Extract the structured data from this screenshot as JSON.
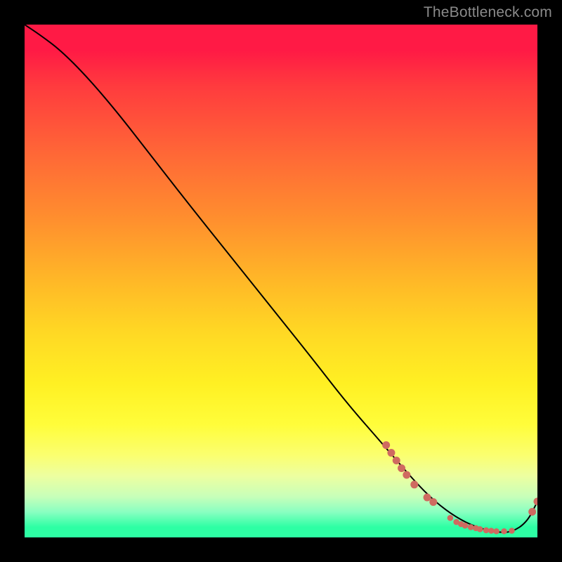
{
  "watermark": "TheBottleneck.com",
  "chart_data": {
    "type": "line",
    "title": "",
    "xlabel": "",
    "ylabel": "",
    "xlim": [
      0,
      100
    ],
    "ylim": [
      0,
      100
    ],
    "grid": false,
    "legend": false,
    "series": [
      {
        "name": "bottleneck-curve",
        "color": "#000000",
        "x": [
          0,
          3,
          7,
          12,
          18,
          25,
          32,
          40,
          48,
          56,
          63,
          70,
          76,
          80,
          84,
          88,
          92,
          95,
          98,
          100
        ],
        "y": [
          100,
          98,
          95,
          90,
          83,
          74,
          65,
          55,
          45,
          35,
          26,
          18,
          11,
          7,
          4,
          2,
          1,
          1,
          3,
          7
        ]
      }
    ],
    "markers": {
      "name": "highlighted-points",
      "color": "#cf6a60",
      "radius_large": 5.5,
      "radius_small": 4.3,
      "points": [
        {
          "x": 70.5,
          "y": 18.0,
          "r": "large"
        },
        {
          "x": 71.5,
          "y": 16.5,
          "r": "large"
        },
        {
          "x": 72.5,
          "y": 15.0,
          "r": "large"
        },
        {
          "x": 73.5,
          "y": 13.5,
          "r": "large"
        },
        {
          "x": 74.5,
          "y": 12.2,
          "r": "large"
        },
        {
          "x": 76.0,
          "y": 10.3,
          "r": "large"
        },
        {
          "x": 78.5,
          "y": 7.8,
          "r": "large"
        },
        {
          "x": 79.7,
          "y": 6.9,
          "r": "large"
        },
        {
          "x": 83.0,
          "y": 3.8,
          "r": "small"
        },
        {
          "x": 84.2,
          "y": 3.0,
          "r": "small"
        },
        {
          "x": 85.1,
          "y": 2.6,
          "r": "small"
        },
        {
          "x": 85.9,
          "y": 2.3,
          "r": "small"
        },
        {
          "x": 87.0,
          "y": 2.0,
          "r": "small"
        },
        {
          "x": 88.0,
          "y": 1.8,
          "r": "small"
        },
        {
          "x": 88.8,
          "y": 1.6,
          "r": "small"
        },
        {
          "x": 90.0,
          "y": 1.4,
          "r": "small"
        },
        {
          "x": 91.0,
          "y": 1.3,
          "r": "small"
        },
        {
          "x": 92.0,
          "y": 1.2,
          "r": "small"
        },
        {
          "x": 93.5,
          "y": 1.2,
          "r": "small"
        },
        {
          "x": 95.0,
          "y": 1.3,
          "r": "small"
        },
        {
          "x": 99.0,
          "y": 5.0,
          "r": "large"
        },
        {
          "x": 100.0,
          "y": 7.0,
          "r": "large"
        }
      ]
    }
  }
}
